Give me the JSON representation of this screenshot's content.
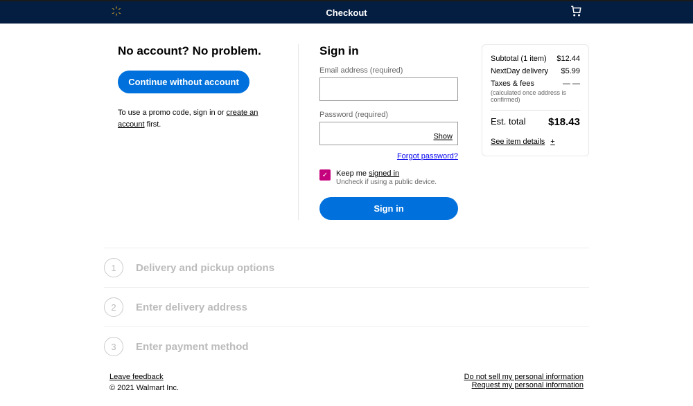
{
  "header": {
    "title": "Checkout"
  },
  "left": {
    "title": "No account? No problem.",
    "continue_label": "Continue without account",
    "promo_text_start": "To use a promo code, sign in or",
    "promo_link": "create an account",
    "promo_text_end": " first."
  },
  "signin": {
    "title": "Sign in",
    "email_label": "Email address (required)",
    "password_label": "Password (required)",
    "show_label": "Show",
    "forgot_label": "Forgot password?",
    "keep_me_prefix": "Keep me ",
    "keep_me_link": "signed in",
    "keep_me_sub": "Uncheck if using a public device.",
    "signin_label": "Sign in"
  },
  "summary": {
    "subtotal_label": "Subtotal (1 item)",
    "subtotal_value": "$12.44",
    "delivery_label": "NextDay delivery",
    "delivery_value": "$5.99",
    "taxes_label": "Taxes & fees",
    "taxes_value": "— —",
    "taxes_note": "(calculated once address is confirmed)",
    "total_label": "Est. total",
    "total_value": "$18.43",
    "see_details": "See item details"
  },
  "steps": [
    {
      "num": "1",
      "label": "Delivery and pickup options"
    },
    {
      "num": "2",
      "label": "Enter delivery address"
    },
    {
      "num": "3",
      "label": "Enter payment method"
    }
  ],
  "footer": {
    "leave_feedback": "Leave feedback",
    "copyright": "© 2021 Walmart Inc.",
    "do_not_sell": "Do not sell my personal information",
    "request_info": "Request my personal information"
  }
}
